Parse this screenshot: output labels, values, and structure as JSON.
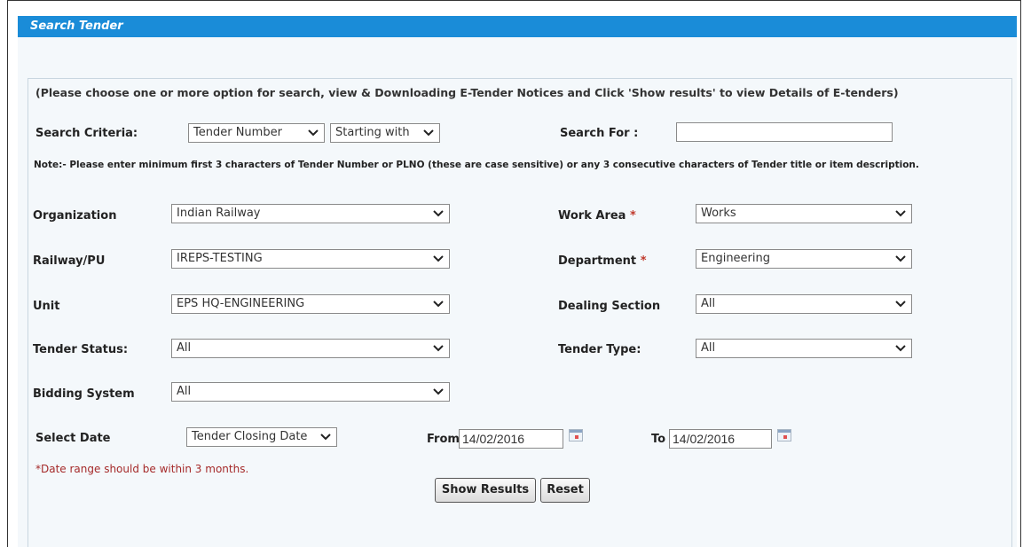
{
  "header": {
    "title": "Search Tender"
  },
  "instruction": "(Please choose one or more option for search, view & Downloading E-Tender Notices and Click 'Show results' to view Details of E-tenders)",
  "search": {
    "criteria_label": "Search Criteria:",
    "criteria_value": "Tender Number",
    "match_value": "Starting with",
    "search_for_label": "Search For :",
    "search_for_value": ""
  },
  "note": "Note:- Please enter minimum first 3 characters of Tender Number or PLNO (these are case sensitive) or any 3 consecutive characters of Tender title or item description.",
  "fields": {
    "organization": {
      "label": "Organization",
      "value": "Indian Railway"
    },
    "railway": {
      "label": "Railway/PU",
      "value": "IREPS-TESTING"
    },
    "unit": {
      "label": "Unit",
      "value": "EPS HQ-ENGINEERING"
    },
    "tender_status": {
      "label": "Tender Status:",
      "value": "All"
    },
    "bidding_system": {
      "label": "Bidding System",
      "value": "All"
    },
    "work_area": {
      "label": "Work Area",
      "required": "*",
      "value": "Works"
    },
    "department": {
      "label": "Department",
      "required": "*",
      "value": "Engineering"
    },
    "dealing_section": {
      "label": "Dealing Section",
      "value": "All"
    },
    "tender_type": {
      "label": "Tender Type:",
      "value": "All"
    }
  },
  "date": {
    "label": "Select Date",
    "type_value": "Tender Closing Date",
    "from_label": "From",
    "from_value": "14/02/2016",
    "to_label": "To",
    "to_value": "14/02/2016",
    "range_note": "*Date range should be within 3 months."
  },
  "buttons": {
    "show_results": "Show Results",
    "reset": "Reset"
  },
  "icons": {
    "dropdown": "chevron-down-icon",
    "calendar": "calendar-icon"
  },
  "colors": {
    "header_bg": "#1a8cd8",
    "panel_bg": "#f4f8fb",
    "required": "#c0392b",
    "warning_text": "#a52a2a"
  }
}
